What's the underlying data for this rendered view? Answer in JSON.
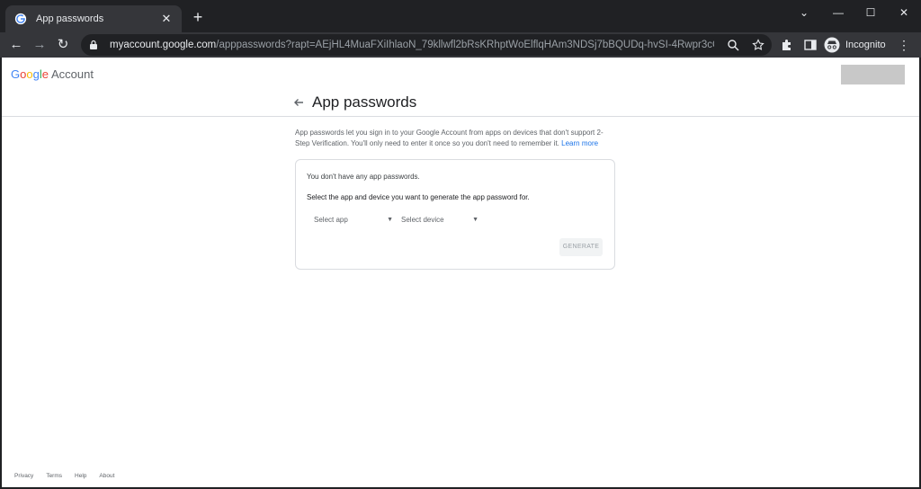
{
  "browser": {
    "tab_title": "App passwords",
    "tab_close": "✕",
    "new_tab": "+",
    "url_host": "myaccount.google.com",
    "url_path": "/apppasswords?rapt=AEjHL4MuaFXiIhlaoN_79kllwfl2bRsKRhptWoElflqHAm3NDSj7bBQUDq-hvSI-4Rwpr3cCzkiZf...",
    "incognito_label": "Incognito",
    "window_controls": {
      "minimize": "—",
      "maximize": "☐",
      "close": "✕"
    },
    "tabsearch": "⌄",
    "nav": {
      "back": "←",
      "forward": "→",
      "reload": "↻"
    },
    "menu": "⋮"
  },
  "header": {
    "brand_letters": [
      "G",
      "o",
      "o",
      "g",
      "l",
      "e"
    ],
    "brand_suffix": "Account",
    "page_title": "App passwords"
  },
  "main": {
    "description": "App passwords let you sign in to your Google Account from apps on devices that don't support 2-Step Verification. You'll only need to enter it once so you don't need to remember it.",
    "learn_more": "Learn more",
    "card": {
      "no_passwords": "You don't have any app passwords.",
      "select_prompt": "Select the app and device you want to generate the app password for.",
      "select_app": "Select app",
      "select_device": "Select device",
      "caret": "▼",
      "generate": "GENERATE"
    }
  },
  "footer": {
    "links": [
      "Privacy",
      "Terms",
      "Help",
      "About"
    ]
  }
}
